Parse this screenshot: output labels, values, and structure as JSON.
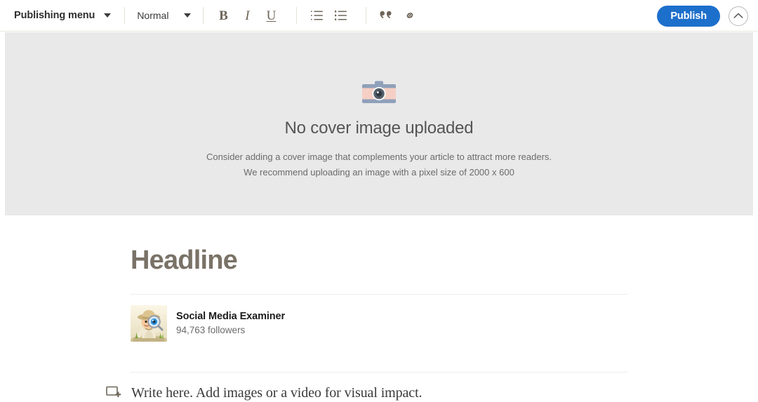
{
  "toolbar": {
    "publishing_menu": {
      "label": "Publishing menu",
      "icon": "caret-down-icon"
    },
    "text_style": {
      "label": "Normal",
      "icon": "caret-down-icon"
    },
    "format_buttons": [
      {
        "name": "bold",
        "label": "B"
      },
      {
        "name": "italic",
        "label": "I"
      },
      {
        "name": "underline",
        "label": "U"
      }
    ],
    "list_buttons": [
      {
        "name": "ordered-list",
        "icon": "ordered-list-icon"
      },
      {
        "name": "bulleted-list",
        "icon": "bulleted-list-icon"
      }
    ],
    "insert_buttons": [
      {
        "name": "blockquote",
        "icon": "quote-icon"
      },
      {
        "name": "link",
        "icon": "link-icon"
      }
    ],
    "publish_label": "Publish",
    "collapse_icon": "chevron-up-icon"
  },
  "cover": {
    "icon": "camera-icon",
    "title": "No cover image uploaded",
    "line1": "Consider adding a cover image that complements your article to attract more readers.",
    "line2": "We recommend uploading an image with a pixel size of 2000 x 600"
  },
  "article": {
    "headline_placeholder": "Headline",
    "author": {
      "avatar_icon": "explorer-avatar",
      "name": "Social Media Examiner",
      "followers": "94,763 followers"
    },
    "body": {
      "add_icon": "add-media-icon",
      "placeholder": "Write here. Add images or a video for visual impact."
    }
  },
  "colors": {
    "publish_blue": "#1d6fcc",
    "cover_bg": "#e9e9e9",
    "headline_gray": "#7a7267",
    "toolbar_icon": "#6e6558",
    "camera_body": "#f6cfc4",
    "camera_band": "#8fa0ba"
  }
}
